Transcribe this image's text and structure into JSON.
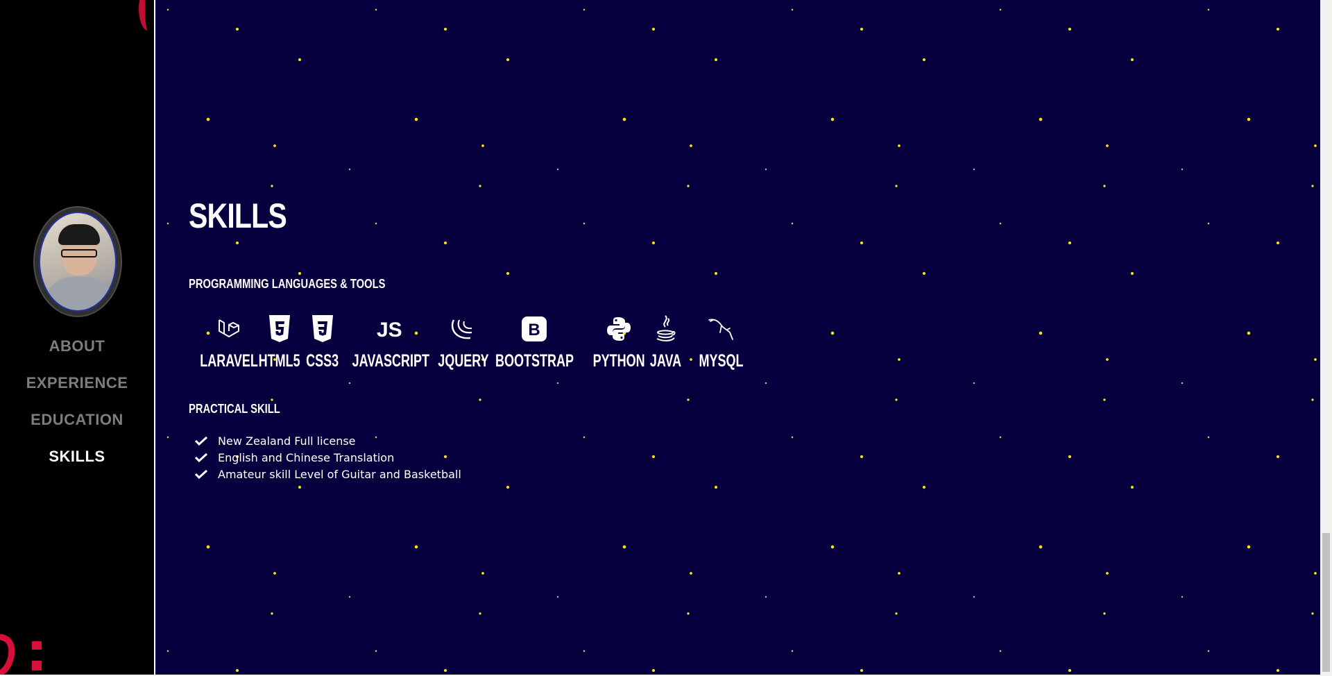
{
  "sidebar": {
    "nav": [
      {
        "label": "ABOUT",
        "active": false
      },
      {
        "label": "EXPERIENCE",
        "active": false
      },
      {
        "label": "EDUCATION",
        "active": false
      },
      {
        "label": "SKILLS",
        "active": true
      }
    ],
    "avatar_icon": "profile-photo"
  },
  "skills": {
    "title": "SKILLS",
    "languages_heading": "PROGRAMMING LANGUAGES & TOOLS",
    "tools": [
      {
        "name": "LARAVEL",
        "icon": "laravel-icon"
      },
      {
        "name": "HTML5",
        "icon": "html5-icon"
      },
      {
        "name": "CSS3",
        "icon": "css3-icon"
      },
      {
        "name": "JAVASCRIPT",
        "icon": "javascript-icon"
      },
      {
        "name": "JQUERY",
        "icon": "jquery-icon"
      },
      {
        "name": "BOOTSTRAP",
        "icon": "bootstrap-icon"
      },
      {
        "name": "PYTHON",
        "icon": "python-icon"
      },
      {
        "name": "JAVA",
        "icon": "java-icon"
      },
      {
        "name": "MYSQL",
        "icon": "mysql-icon"
      }
    ],
    "practical_heading": "PRACTICAL SKILL",
    "practical": [
      "New Zealand Full license",
      "English and Chinese Translation",
      "Amateur skill Level of Guitar and Basketball"
    ]
  },
  "colors": {
    "background": "#07003e",
    "stars": "#f4e400",
    "sidebar": "#000000",
    "nav_inactive": "#7d7d7d",
    "nav_active": "#ffffff"
  }
}
